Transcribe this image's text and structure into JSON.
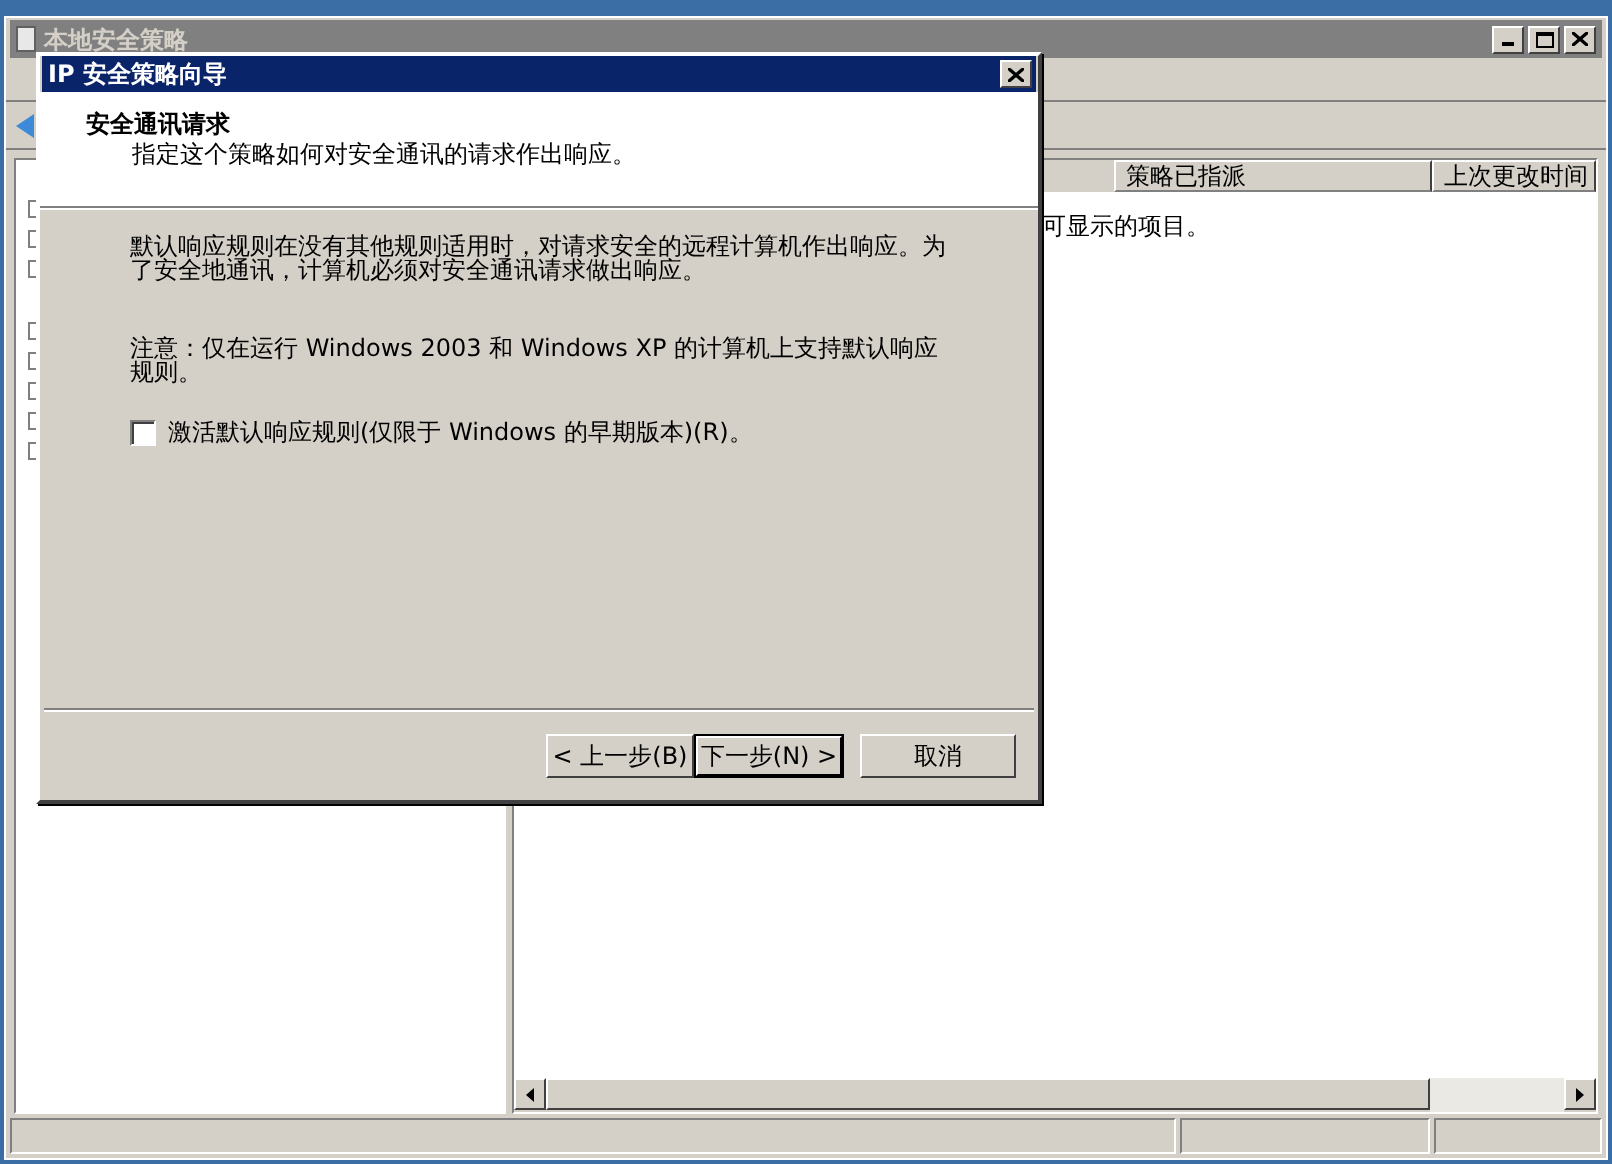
{
  "main_window": {
    "title": "本地安全策略",
    "columns": [
      {
        "label": "策略已指派"
      },
      {
        "label": "上次更改时间"
      }
    ],
    "message": "可显示的项目。"
  },
  "dialog": {
    "title": "IP 安全策略向导",
    "heading": "安全通讯请求",
    "subheading": "指定这个策略如何对安全通讯的请求作出响应。",
    "paragraphs": [
      "默认响应规则在没有其他规则适用时，对请求安全的远程计算机作出响应。为了安全地通讯，计算机必须对安全通讯请求做出响应。",
      "注意：仅在运行 Windows 2003 和 Windows XP 的计算机上支持默认响应规则。"
    ],
    "checkbox": {
      "label": "激活默认响应规则(仅限于 Windows 的早期版本)(R)。",
      "checked": false
    },
    "buttons": [
      {
        "label": "< 上一步(B)",
        "default": false
      },
      {
        "label": "下一步(N) >",
        "default": true
      },
      {
        "label": "取消",
        "default": false
      }
    ]
  }
}
